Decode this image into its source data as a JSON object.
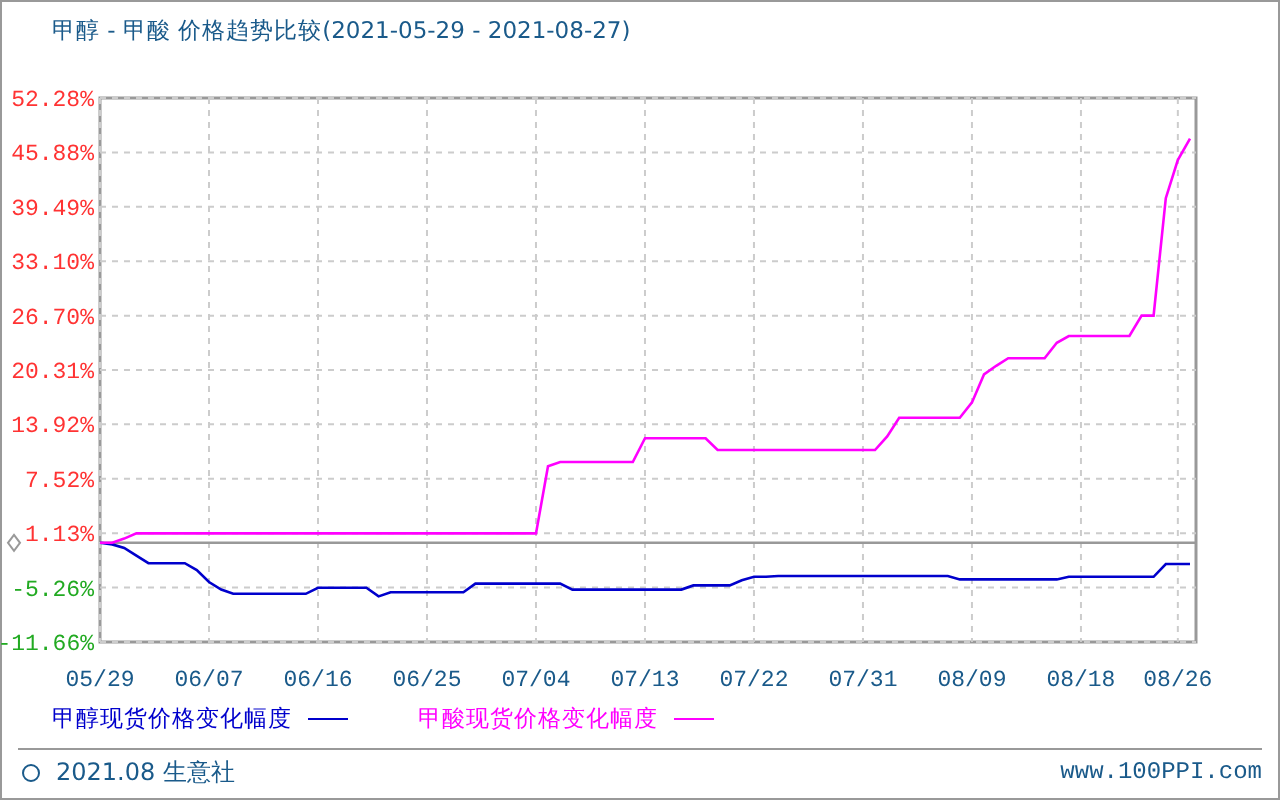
{
  "title": "甲醇 - 甲酸 价格趋势比较(2021-05-29 - 2021-08-27)",
  "chart_data": {
    "type": "line",
    "grid": true,
    "categories": [
      "05/29",
      null,
      null,
      null,
      null,
      null,
      null,
      null,
      null,
      "06/07",
      null,
      null,
      null,
      null,
      null,
      null,
      null,
      null,
      "06/16",
      null,
      null,
      null,
      null,
      null,
      null,
      null,
      null,
      "06/25",
      null,
      null,
      null,
      null,
      null,
      null,
      null,
      null,
      "07/04",
      null,
      null,
      null,
      null,
      null,
      null,
      null,
      null,
      "07/13",
      null,
      null,
      null,
      null,
      null,
      null,
      null,
      null,
      "07/22",
      null,
      null,
      null,
      null,
      null,
      null,
      null,
      null,
      "07/31",
      null,
      null,
      null,
      null,
      null,
      null,
      null,
      null,
      "08/09",
      null,
      null,
      null,
      null,
      null,
      null,
      null,
      null,
      "08/18",
      null,
      null,
      null,
      null,
      null,
      null,
      null,
      "08/26",
      null
    ],
    "ylim": [
      -11.66,
      52.28
    ],
    "yticks": [
      {
        "value": 52.28,
        "label": "52.28%"
      },
      {
        "value": 45.88,
        "label": "45.88%"
      },
      {
        "value": 39.49,
        "label": "39.49%"
      },
      {
        "value": 33.1,
        "label": "33.10%"
      },
      {
        "value": 26.7,
        "label": "26.70%"
      },
      {
        "value": 20.31,
        "label": "20.31%"
      },
      {
        "value": 13.92,
        "label": "13.92%"
      },
      {
        "value": 7.52,
        "label": "7.52%"
      },
      {
        "value": 1.13,
        "label": "1.13%"
      },
      {
        "value": -5.26,
        "label": "-5.26%"
      },
      {
        "value": -11.66,
        "label": "-11.66%"
      }
    ],
    "series": [
      {
        "name": "甲醇现货价格变化幅度",
        "color": "#0000cc",
        "values": [
          0,
          -0.2,
          -0.6,
          -1.5,
          -2.4,
          -2.4,
          -2.4,
          -2.4,
          -3.2,
          -4.6,
          -5.5,
          -6,
          -6,
          -6,
          -6,
          -6,
          -6,
          -6,
          -5.3,
          -5.3,
          -5.3,
          -5.3,
          -5.3,
          -6.3,
          -5.8,
          -5.8,
          -5.8,
          -5.8,
          -5.8,
          -5.8,
          -5.8,
          -4.8,
          -4.8,
          -4.8,
          -4.8,
          -4.8,
          -4.8,
          -4.8,
          -4.8,
          -5.5,
          -5.5,
          -5.5,
          -5.5,
          -5.5,
          -5.5,
          -5.5,
          -5.5,
          -5.5,
          -5.5,
          -5,
          -5,
          -5,
          -5,
          -4.4,
          -4,
          -4,
          -3.9,
          -3.9,
          -3.9,
          -3.9,
          -3.9,
          -3.9,
          -3.9,
          -3.9,
          -3.9,
          -3.9,
          -3.9,
          -3.9,
          -3.9,
          -3.9,
          -3.9,
          -4.3,
          -4.3,
          -4.3,
          -4.3,
          -4.3,
          -4.3,
          -4.3,
          -4.3,
          -4.3,
          -4,
          -4,
          -4,
          -4,
          -4,
          -4,
          -4,
          -4,
          -2.5,
          -2.5,
          -2.5
        ]
      },
      {
        "name": "甲酸现货价格变化幅度",
        "color": "#ff00ff",
        "values": [
          0,
          0,
          0.5,
          1.1,
          1.1,
          1.1,
          1.1,
          1.1,
          1.1,
          1.1,
          1.1,
          1.1,
          1.1,
          1.1,
          1.1,
          1.1,
          1.1,
          1.1,
          1.1,
          1.1,
          1.1,
          1.1,
          1.1,
          1.1,
          1.1,
          1.1,
          1.1,
          1.1,
          1.1,
          1.1,
          1.1,
          1.1,
          1.1,
          1.1,
          1.1,
          1.1,
          1.1,
          9,
          9.5,
          9.5,
          9.5,
          9.5,
          9.5,
          9.5,
          9.5,
          12.3,
          12.3,
          12.3,
          12.3,
          12.3,
          12.3,
          10.9,
          10.9,
          10.9,
          10.9,
          10.9,
          10.9,
          10.9,
          10.9,
          10.9,
          10.9,
          10.9,
          10.9,
          10.9,
          10.9,
          12.5,
          14.7,
          14.7,
          14.7,
          14.7,
          14.7,
          14.7,
          16.5,
          19.8,
          20.8,
          21.7,
          21.7,
          21.7,
          21.7,
          23.5,
          24.3,
          24.3,
          24.3,
          24.3,
          24.3,
          24.3,
          26.7,
          26.7,
          40.5,
          45,
          47.5
        ]
      }
    ]
  },
  "footer": {
    "copyright": "2021.08 生意社",
    "site": "www.100PPI.com"
  }
}
